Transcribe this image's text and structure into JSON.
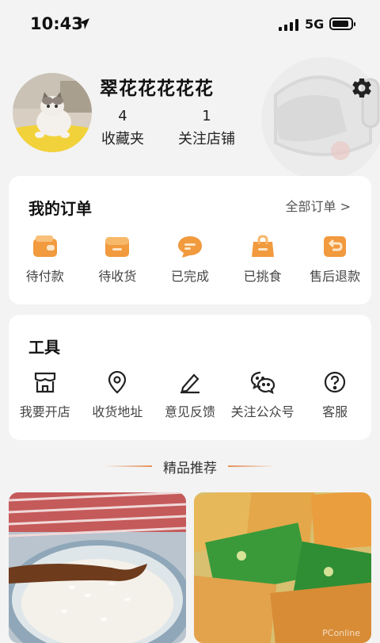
{
  "status_bar": {
    "time": "10:43",
    "network": "5G"
  },
  "profile": {
    "username": "翠花花花花花",
    "stats": [
      {
        "value": "4",
        "label": "收藏夹"
      },
      {
        "value": "1",
        "label": "关注店铺"
      }
    ]
  },
  "orders": {
    "title": "我的订单",
    "all_link": "全部订单 >",
    "items": [
      {
        "label": "待付款",
        "icon": "wallet-icon"
      },
      {
        "label": "待收货",
        "icon": "package-icon"
      },
      {
        "label": "已完成",
        "icon": "chat-bubble-icon"
      },
      {
        "label": "已挑食",
        "icon": "shopping-bag-icon"
      },
      {
        "label": "售后退款",
        "icon": "refund-icon"
      }
    ]
  },
  "tools": {
    "title": "工具",
    "items": [
      {
        "label": "我要开店",
        "icon": "store-icon"
      },
      {
        "label": "收货地址",
        "icon": "location-pin-icon"
      },
      {
        "label": "意见反馈",
        "icon": "pencil-icon"
      },
      {
        "label": "关注公众号",
        "icon": "wechat-icon"
      },
      {
        "label": "客服",
        "icon": "help-icon"
      }
    ]
  },
  "recommend": {
    "title": "精品推荐"
  },
  "watermark": "PConline",
  "colors": {
    "accent": "#f5a34a",
    "accent_dark": "#ef8a2e",
    "background": "#f3f3f3"
  }
}
